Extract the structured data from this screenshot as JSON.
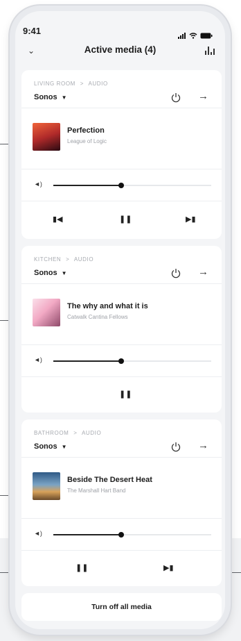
{
  "status_bar": {
    "time": "9:41"
  },
  "header": {
    "title": "Active media (4)"
  },
  "cards": [
    {
      "room": "LIVING ROOM",
      "category": "AUDIO",
      "device": "Sonos",
      "track_title": "Perfection",
      "artist": "League of Logic",
      "volume": 0.43,
      "controls": [
        "previous",
        "pause",
        "next"
      ],
      "art_colors": [
        "#e24a2b",
        "#3b0b14"
      ]
    },
    {
      "room": "KITCHEN",
      "category": "AUDIO",
      "device": "Sonos",
      "track_title": "The why and what it is",
      "artist": "Catwalk Cantina Fellows",
      "volume": 0.43,
      "controls": [
        "pause"
      ],
      "art_colors": [
        "#f5c2d6",
        "#b86f8f"
      ]
    },
    {
      "room": "BATHROOM",
      "category": "AUDIO",
      "device": "Sonos",
      "track_title": "Beside The Desert Heat",
      "artist": "The Marshall Hart Band",
      "volume": 0.43,
      "controls": [
        "pause",
        "next"
      ],
      "art_colors": [
        "#2b4d73",
        "#d9a35a"
      ]
    }
  ],
  "footer": {
    "turn_off_label": "Turn off all media"
  },
  "icons": {
    "back": "chevron-down-icon",
    "equalizer": "equalizer-icon",
    "power": "power-icon",
    "arrow": "arrow-right-icon",
    "volume": "speaker-icon"
  },
  "separator": ">"
}
